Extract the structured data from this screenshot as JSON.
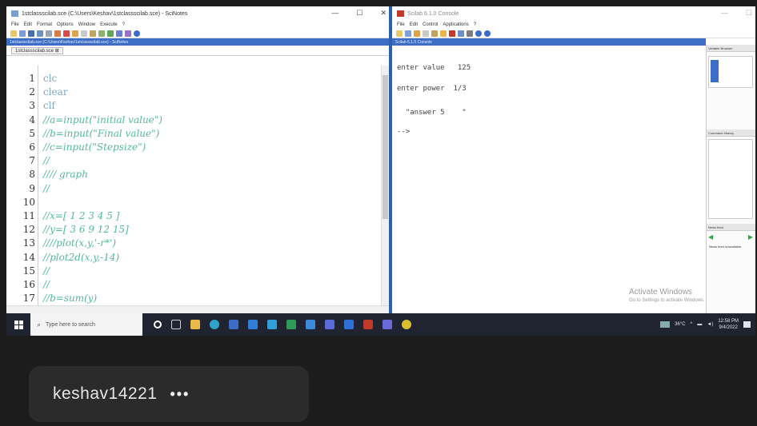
{
  "scinotes": {
    "title": "1stclassscilab.sce (C:\\Users\\Keshav\\1stclassscilab.sce) - SciNotes",
    "menu": [
      "File",
      "Edit",
      "Format",
      "Options",
      "Window",
      "Execute",
      "?"
    ],
    "docbar": "1stclassscilab.sce (C:\\Users\\Keshav\\1stclassscilab.sce) - SciNotes",
    "tab": "1stclassscilab.sce",
    "tab_close": "⊠",
    "lines": [
      {
        "num": "1",
        "text": "clc",
        "kind": "kw"
      },
      {
        "num": "2",
        "text": "clear",
        "kind": "kw"
      },
      {
        "num": "3",
        "text": "clf",
        "kind": "kw"
      },
      {
        "num": "4",
        "text": "//a=input(\"initial value\")",
        "kind": "cm"
      },
      {
        "num": "5",
        "text": "//b=input(\"Final value\")",
        "kind": "cm"
      },
      {
        "num": "6",
        "text": "//c=input(\"Stepsize\")",
        "kind": "cm"
      },
      {
        "num": "7",
        "text": "//",
        "kind": "cm"
      },
      {
        "num": "8",
        "text": "//// graph",
        "kind": "cm"
      },
      {
        "num": "9",
        "text": "//",
        "kind": "cm"
      },
      {
        "num": "10",
        "text": "",
        "kind": "cm"
      },
      {
        "num": "11",
        "text": "//x=[ 1 2 3 4 5 ]",
        "kind": "cm"
      },
      {
        "num": "12",
        "text": "//y=[ 3 6 9 12 15]",
        "kind": "cm"
      },
      {
        "num": "13",
        "text": "////plot(x,y,'-r*')",
        "kind": "cm"
      },
      {
        "num": "14",
        "text": "//plot2d(x,y,-14)",
        "kind": "cm"
      },
      {
        "num": "15",
        "text": "//",
        "kind": "cm"
      },
      {
        "num": "16",
        "text": "//",
        "kind": "cm"
      },
      {
        "num": "17",
        "text": "//b=sum(y)",
        "kind": "cm"
      }
    ]
  },
  "console": {
    "title": "Scilab 6.1.0 Console",
    "menu": [
      "File",
      "Edit",
      "Control",
      "Applications",
      "?"
    ],
    "docbar": "Scilab 6.1.0 Console",
    "lines": [
      {
        "text": "enter value   125"
      },
      {
        "text": "enter power  1/3"
      },
      {
        "text": "  \"answer 5    \""
      },
      {
        "text": "-->"
      }
    ],
    "side_headers": [
      "Variable Browser",
      "Command History",
      "News feed"
    ],
    "news_text": "News feed unavailable."
  },
  "watermark": {
    "title": "Activate Windows",
    "sub": "Go to Settings to activate Windows."
  },
  "taskbar": {
    "search_placeholder": "Type here to search",
    "weather": "36°C",
    "time": "12:58 PM",
    "date": "9/4/2022"
  },
  "user": {
    "name": "keshav14221",
    "more": "•••"
  },
  "colors": {
    "accent": "#2f5fb3",
    "keyword": "#7aa9c0",
    "comment": "#56b89a"
  }
}
